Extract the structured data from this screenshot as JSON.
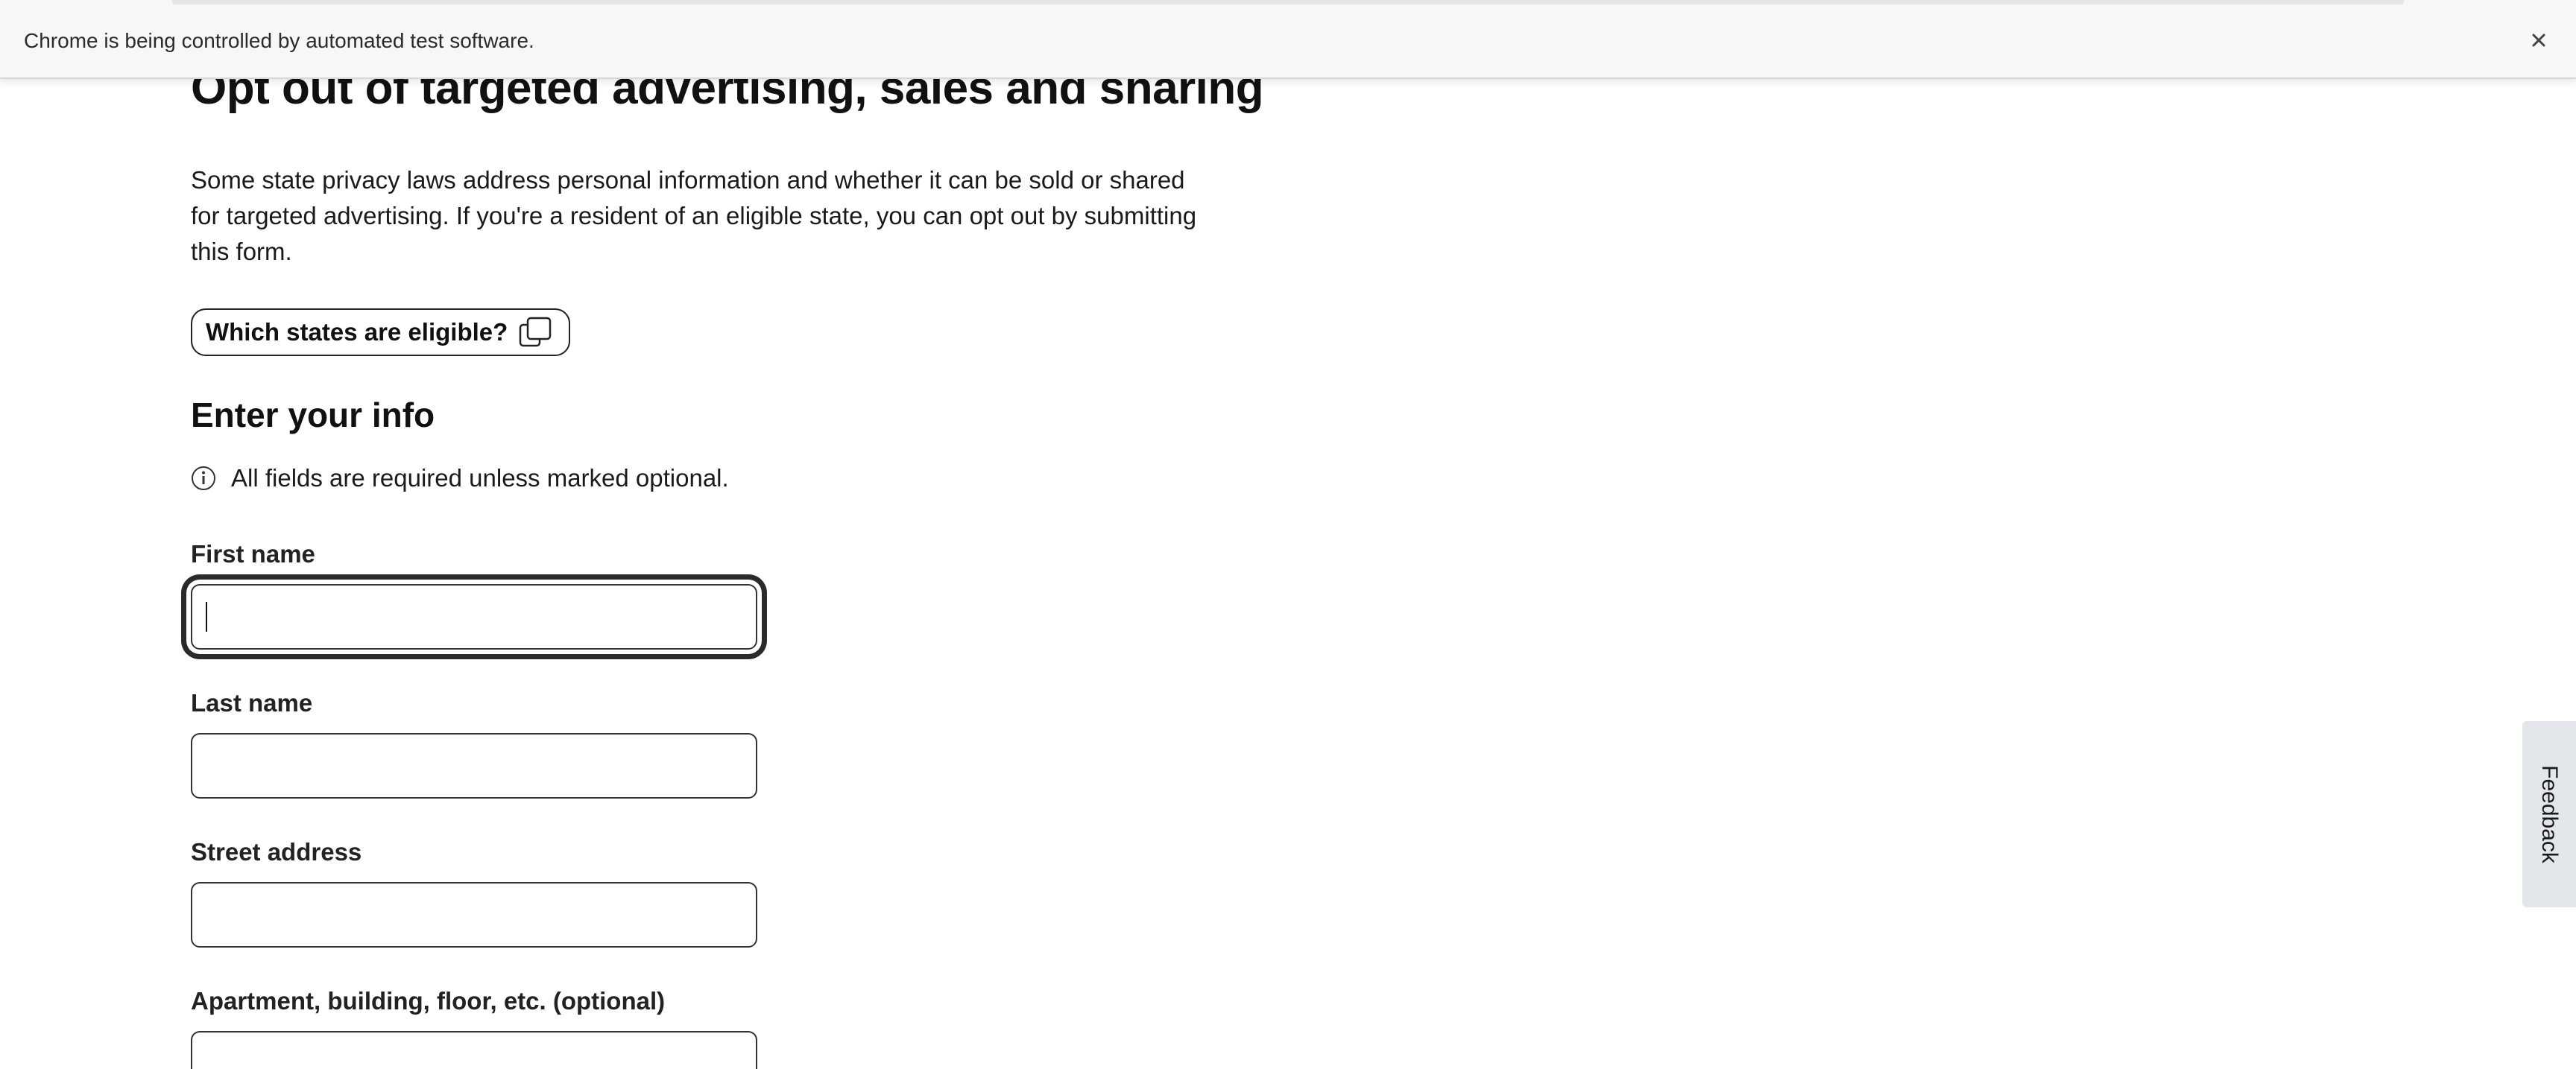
{
  "browser": {
    "infobar_text": "Chrome is being controlled by automated test software.",
    "close_icon": "close-icon"
  },
  "main": {
    "title": "Opt out of targeted advertising, sales and sharing",
    "intro": "Some state privacy laws address personal information and whether it can be sold or shared for targeted advertising. If you're a resident of an eligible state, you can opt out by submitting this form.",
    "eligible_button": {
      "label": "Which states are eligible?",
      "icon": "open-in-new-window-icon"
    },
    "section_title": "Enter your info",
    "required_note": {
      "icon": "info-icon",
      "text": "All fields are required unless marked optional."
    },
    "fields": [
      {
        "label": "First name",
        "value": "",
        "focused": true
      },
      {
        "label": "Last name",
        "value": ""
      },
      {
        "label": "Street address",
        "value": ""
      },
      {
        "label": "Apartment, building, floor, etc. (optional)",
        "value": ""
      }
    ]
  },
  "feedback_tab": {
    "label": "Feedback"
  },
  "colors": {
    "text": "#111111",
    "border": "#333333",
    "infobar_bg": "#f7f7f7",
    "feedback_bg": "#e3e6eb"
  }
}
